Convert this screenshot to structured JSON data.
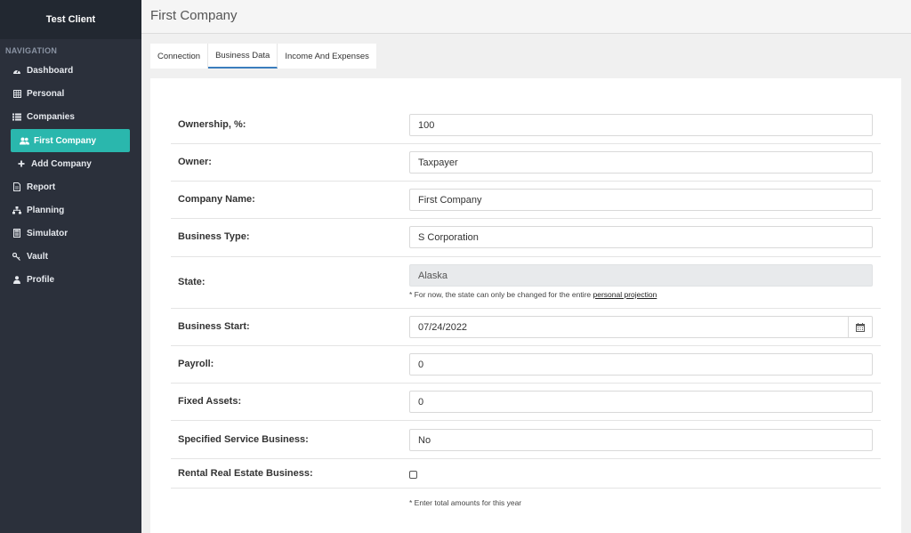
{
  "sidebar": {
    "client_name": "Test Client",
    "nav_heading": "NAVIGATION",
    "items": [
      {
        "label": "Dashboard",
        "icon": "dashboard-icon"
      },
      {
        "label": "Personal",
        "icon": "grid-icon"
      },
      {
        "label": "Companies",
        "icon": "list-icon"
      },
      {
        "label": "First Company",
        "icon": "users-icon",
        "active": true
      },
      {
        "label": "Add Company",
        "icon": "plus-icon"
      },
      {
        "label": "Report",
        "icon": "file-icon"
      },
      {
        "label": "Planning",
        "icon": "sitemap-icon"
      },
      {
        "label": "Simulator",
        "icon": "calculator-icon"
      },
      {
        "label": "Vault",
        "icon": "key-icon"
      },
      {
        "label": "Profile",
        "icon": "user-icon"
      }
    ]
  },
  "header": {
    "title": "First Company"
  },
  "tabs": [
    {
      "label": "Connection"
    },
    {
      "label": "Business Data",
      "active": true
    },
    {
      "label": "Income And Expenses"
    }
  ],
  "form": {
    "ownership": {
      "label": "Ownership, %:",
      "value": "100"
    },
    "owner": {
      "label": "Owner:",
      "value": "Taxpayer"
    },
    "company_name": {
      "label": "Company Name:",
      "value": "First Company"
    },
    "business_type": {
      "label": "Business Type:",
      "value": "S Corporation"
    },
    "state": {
      "label": "State:",
      "value": "Alaska",
      "note": "* For now, the state can only be changed for the entire ",
      "note_link": "personal projection"
    },
    "business_start": {
      "label": "Business Start:",
      "value": "07/24/2022"
    },
    "payroll": {
      "label": "Payroll:",
      "value": "0"
    },
    "fixed_assets": {
      "label": "Fixed Assets:",
      "value": "0"
    },
    "specified_service": {
      "label": "Specified Service Business:",
      "value": "No"
    },
    "rental_real_estate": {
      "label": "Rental Real Estate Business:",
      "checked": false
    }
  },
  "footnote": "* Enter total amounts for this year",
  "colors": {
    "accent": "#2ab7ad",
    "sidebar": "#2b303b",
    "sidebar_header": "#222831"
  }
}
